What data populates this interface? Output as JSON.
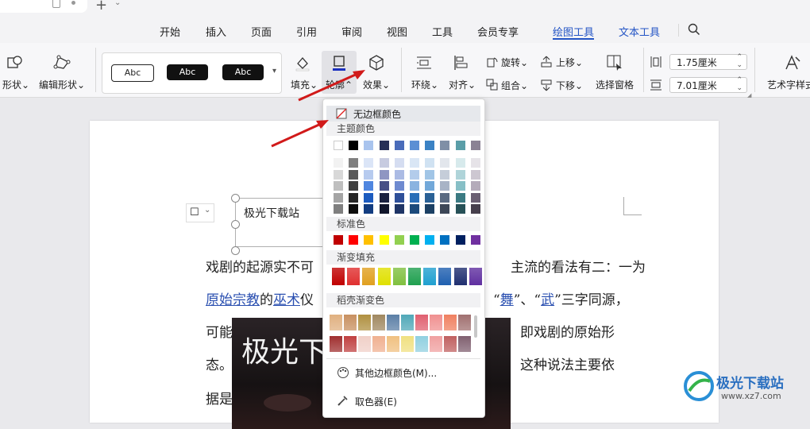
{
  "menu": {
    "tabs": [
      "开始",
      "插入",
      "页面",
      "引用",
      "审阅",
      "视图",
      "工具",
      "会员专享",
      "绘图工具",
      "文本工具"
    ],
    "active": "绘图工具"
  },
  "ribbon": {
    "shape_label": "形状",
    "edit_shape_label": "编辑形状",
    "style_samples": [
      "Abc",
      "Abc",
      "Abc"
    ],
    "fill_label": "填充",
    "outline_label": "轮廓",
    "effect_label": "效果",
    "wrap_label": "环绕",
    "align_label": "对齐",
    "rotate_label": "旋转",
    "group_label": "组合",
    "up_label": "上移",
    "down_label": "下移",
    "select_pane_label": "选择窗格",
    "height_value": "1.75厘米",
    "width_value": "7.01厘米",
    "art_text_label": "艺术字样式"
  },
  "document": {
    "textbox_text": "极光下载站",
    "line1_a": "戏剧的起源实不可",
    "line1_b": "主流的看法有二：一为",
    "line2_link1": "原始宗教",
    "line2_mid": "的",
    "line2_link2": "巫术",
    "line2_c": "仪",
    "line2_d": "“",
    "line2_link3": "舞",
    "line2_e": "”、“",
    "line2_link4": "武",
    "line2_f": "”三字同源，",
    "line3_a": "可能",
    "line3_b": "即戏剧的原始形",
    "line4_a": "态。",
    "line4_b": "这种说法主要依",
    "line5_a": "据是",
    "image_text": "极光下"
  },
  "dropdown": {
    "no_border_label": "无边框颜色",
    "theme_colors_label": "主题颜色",
    "theme_top": [
      "#ffffff",
      "#000000",
      "#a9c4ee",
      "#262f56",
      "#4a6cba",
      "#5b8fd4",
      "#3b82c4",
      "#7f8fa6",
      "#5a9ea8",
      "#8b8294"
    ],
    "theme_shades": [
      [
        "#f2f2f2",
        "#7f7f7f",
        "#dbe5f7",
        "#c7cbe0",
        "#d5ddf1",
        "#d9e6f5",
        "#d0e2f2",
        "#e2e6ec",
        "#d7eaec",
        "#e6e3e8"
      ],
      [
        "#d8d8d8",
        "#595959",
        "#b7cbef",
        "#8f96c2",
        "#abbbe4",
        "#b3cceb",
        "#a1c5e6",
        "#c5cdd9",
        "#afd4d9",
        "#cdc7d1"
      ],
      [
        "#bfbfbf",
        "#3f3f3f",
        "#4f86e0",
        "#474f86",
        "#6e8ad0",
        "#8ab3e0",
        "#72a8d9",
        "#a8b3c6",
        "#87bfc6",
        "#b4abba"
      ],
      [
        "#a5a5a5",
        "#262626",
        "#1c5bbf",
        "#1b2240",
        "#2e4f99",
        "#2a6fb8",
        "#2a6196",
        "#5b6b82",
        "#3b7a82",
        "#6a5f72"
      ],
      [
        "#7f7f7f",
        "#0c0c0c",
        "#123c80",
        "#11162b",
        "#1f3566",
        "#1c4a7b",
        "#1c4064",
        "#3d4757",
        "#275157",
        "#463f4c"
      ]
    ],
    "standard_label": "标准色",
    "standard_colors": [
      "#c00000",
      "#ff0000",
      "#ffc000",
      "#ffff00",
      "#92d050",
      "#00b050",
      "#00b0f0",
      "#0070c0",
      "#002060",
      "#7030a0"
    ],
    "gradient_label": "渐变填充",
    "gradient_colors": [
      "#c00000",
      "#e03030",
      "#e0a020",
      "#e0e000",
      "#80c040",
      "#20a050",
      "#20a0d0",
      "#2060b0",
      "#203070",
      "#6030a0"
    ],
    "shell_label": "稻壳渐变色",
    "shell_row1": [
      "#e0b080",
      "#c89060",
      "#b09040",
      "#a08860",
      "#5b7fa6",
      "#50a8b8",
      "#e06070",
      "#f09090",
      "#f08060",
      "#a07070"
    ],
    "shell_row2": [
      "#a03030",
      "#c04040",
      "#f0d0c8",
      "#f0b090",
      "#f0c080",
      "#f0e080",
      "#90d0e0",
      "#f0a0a0",
      "#c06060",
      "#806070"
    ],
    "more_colors_label": "其他边框颜色(M)...",
    "eyedropper_label": "取色器(E)"
  },
  "watermark": {
    "text": "极光下载站",
    "url": "www.xz7.com"
  },
  "accent": "#2455c5"
}
